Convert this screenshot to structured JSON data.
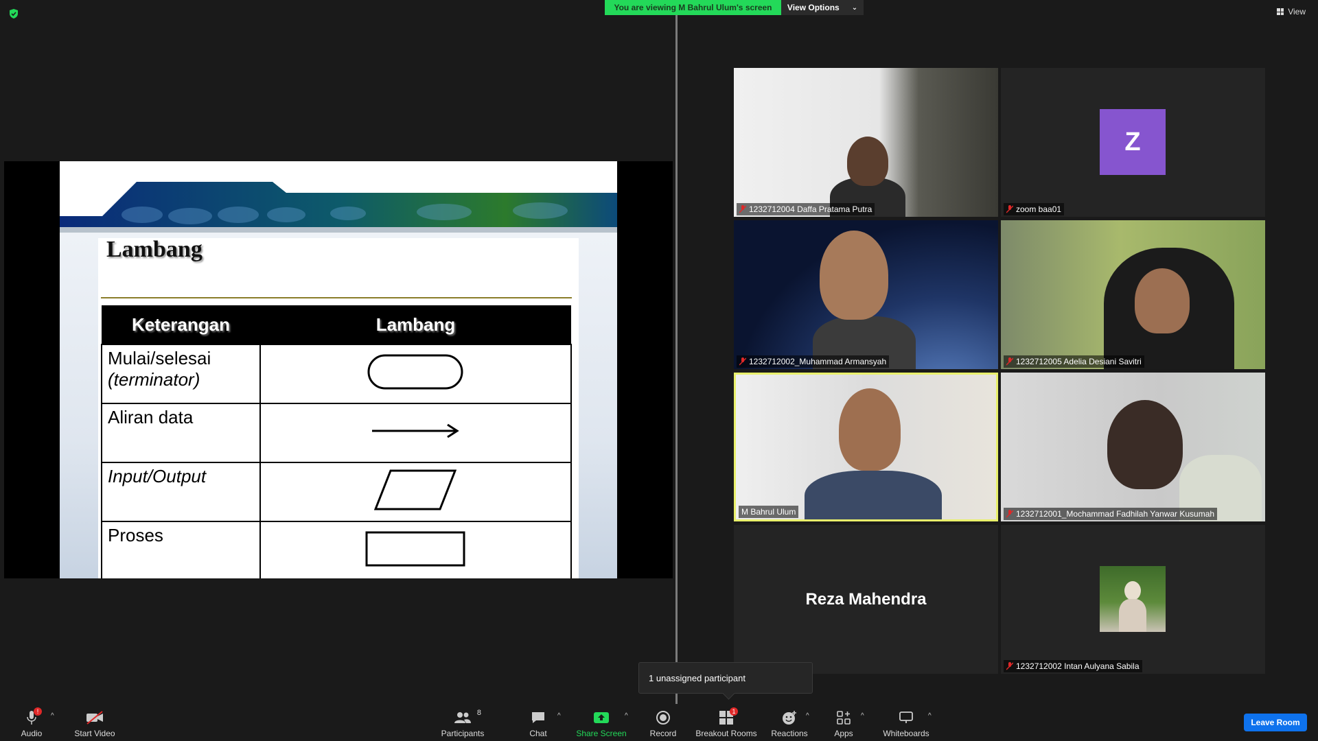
{
  "banner": {
    "viewing": "You are viewing M Bahrul Ulum's screen",
    "view_options": "View Options"
  },
  "top_right": {
    "view": "View"
  },
  "slide": {
    "title": "Lambang",
    "headers": [
      "Keterangan",
      "Lambang"
    ],
    "rows": [
      {
        "label_line1": "Mulai/selesai",
        "label_line2": "(terminator)",
        "shape": "terminator"
      },
      {
        "label_line1": "Aliran data",
        "label_line2": "",
        "shape": "arrow"
      },
      {
        "label_line1": "Input/Output",
        "label_line2": "",
        "shape": "parallelogram"
      },
      {
        "label_line1": "Proses",
        "label_line2": "",
        "shape": "rectangle"
      }
    ]
  },
  "participants": [
    {
      "name": "1232712004 Daffa Pratama Putra",
      "muted": true
    },
    {
      "name": "zoom baa01",
      "muted": true,
      "avatar_letter": "Z",
      "avatar_color": "#8655cf"
    },
    {
      "name": "1232712002_Muhammad Armansyah",
      "muted": true
    },
    {
      "name": "1232712005 Adelia Desiani Savitri",
      "muted": true
    },
    {
      "name": "M Bahrul Ulum",
      "muted": false,
      "active_speaker": true
    },
    {
      "name": "1232712001_Mochammad Fadhilah Yanwar Kusumah",
      "muted": true
    },
    {
      "big_name": "Reza Mahendra"
    },
    {
      "name": "1232712002 Intan Aulyana Sabila",
      "muted": true
    }
  ],
  "tooltip": {
    "text": "1 unassigned participant"
  },
  "toolbar": {
    "audio": "Audio",
    "start_video": "Start Video",
    "participants": "Participants",
    "participants_count": "8",
    "chat": "Chat",
    "share_screen": "Share Screen",
    "record": "Record",
    "breakout_rooms": "Breakout Rooms",
    "breakout_badge": "1",
    "reactions": "Reactions",
    "apps": "Apps",
    "whiteboards": "Whiteboards",
    "leave_room": "Leave Room",
    "audio_badge": "!"
  },
  "colors": {
    "banner_green": "#23d959",
    "speaker_border": "#e9f06b",
    "leave_blue": "#0e72ed"
  }
}
